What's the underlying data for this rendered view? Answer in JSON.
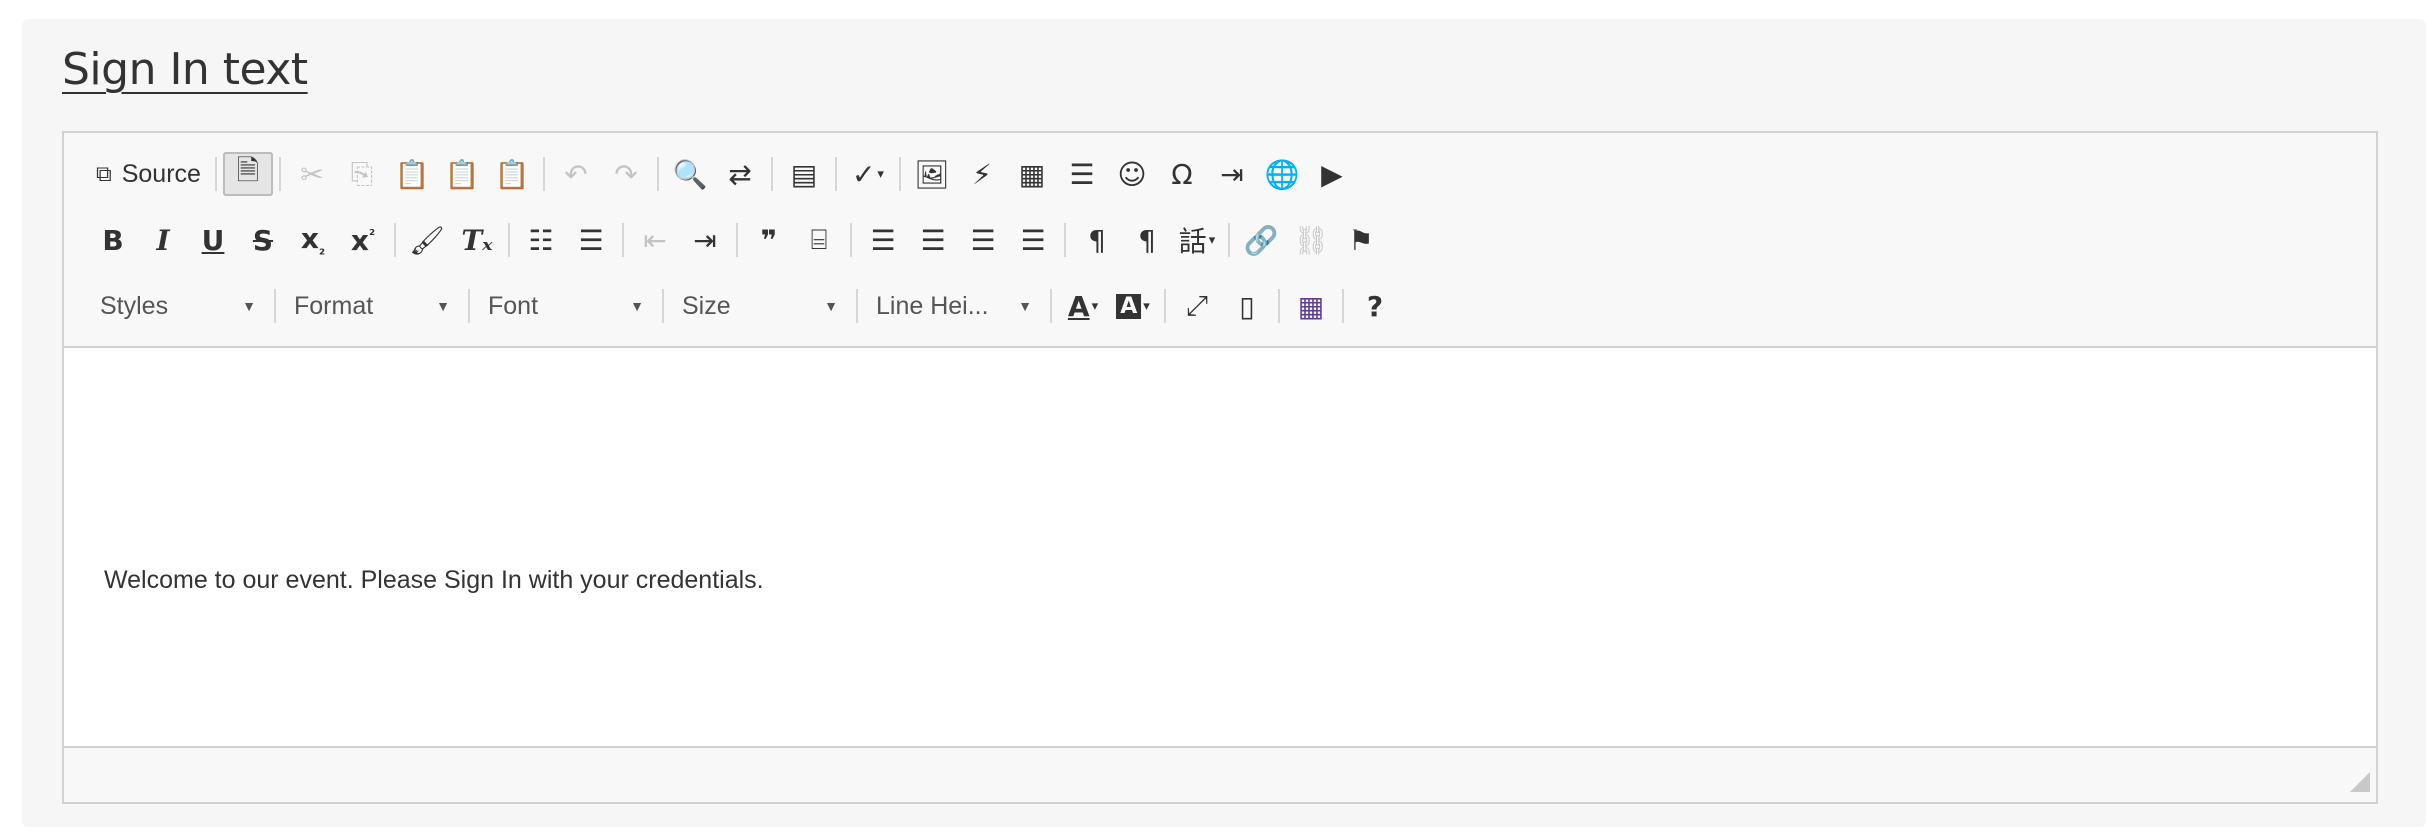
{
  "heading": "Sign In text",
  "toolbar": {
    "source_label": "Source",
    "styles_label": "Styles",
    "format_label": "Format",
    "font_label": "Font",
    "size_label": "Size",
    "line_height_label": "Line Hei...",
    "help_label": "?"
  },
  "content": {
    "text": "Welcome to our event. Please Sign In with your credentials."
  },
  "colors": {
    "panel_bg": "#f6f6f6",
    "border": "#d1d1d1",
    "text": "#333333",
    "disabled": "#c4c4c4",
    "table_grid_icon": "#5b3f8a"
  }
}
